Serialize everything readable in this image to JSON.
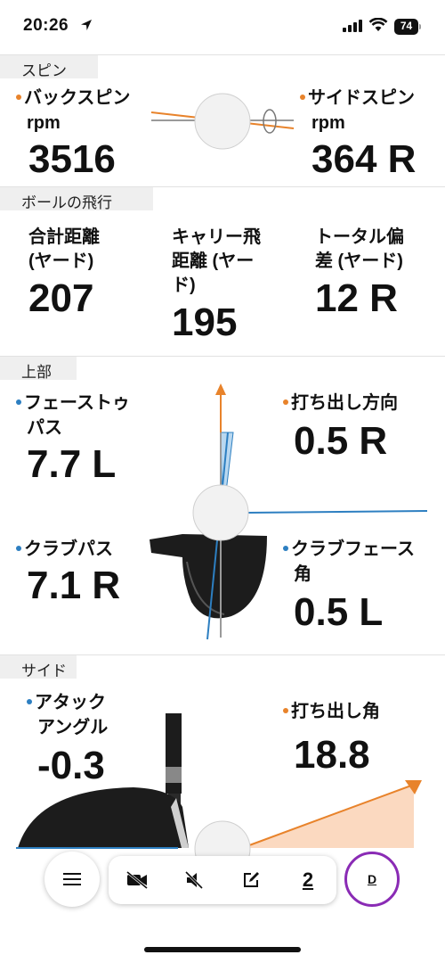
{
  "status_bar": {
    "time": "20:26",
    "battery": "74"
  },
  "sections": {
    "spin": "スピン",
    "flight": "ボールの飛行",
    "top": "上部",
    "side": "サイド"
  },
  "spin": {
    "back_label_1": "バックスピン",
    "back_label_2": "rpm",
    "back_value": "3516",
    "side_label_1": "サイドスピン",
    "side_label_2": "rpm",
    "side_value": "364 R"
  },
  "flight": {
    "total_label_1": "合計距離",
    "total_label_2": "(ヤード)",
    "total_value": "207",
    "carry_label_1": "キャリー飛",
    "carry_label_2": "距離 (ヤー",
    "carry_label_3": "ド)",
    "carry_value": "195",
    "offline_label_1": "トータル偏",
    "offline_label_2": "差 (ヤード)",
    "offline_value": "12 R"
  },
  "top": {
    "face_to_path_label_1": "フェーストゥ",
    "face_to_path_label_2": "パス",
    "face_to_path_value": "7.7 L",
    "launch_dir_label": "打ち出し方向",
    "launch_dir_value": "0.5 R",
    "club_path_label": "クラブパス",
    "club_path_value": "7.1 R",
    "face_angle_label_1": "クラブフェース",
    "face_angle_label_2": "角",
    "face_angle_value": "0.5 L"
  },
  "side": {
    "attack_label_1": "アタック",
    "attack_label_2": "アングル",
    "attack_value": "-0.3",
    "launch_angle_label": "打ち出し角",
    "launch_angle_value": "18.8"
  },
  "toolbar": {
    "page_number": "2",
    "club": "D",
    "icons": [
      "menu-icon",
      "video-off-icon",
      "mute-icon",
      "edit-icon"
    ]
  },
  "colors": {
    "orange": "#e8832b",
    "blue": "#2d7fc1",
    "accent": "#8a2bb5"
  }
}
